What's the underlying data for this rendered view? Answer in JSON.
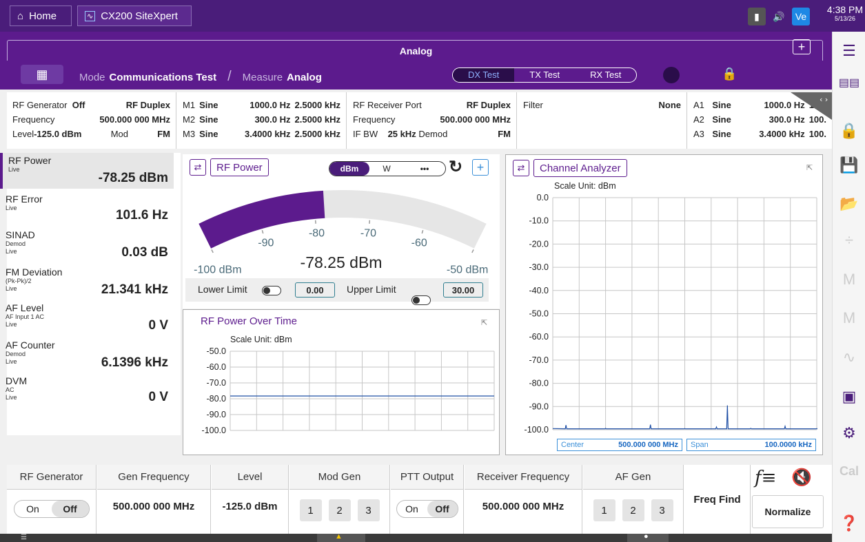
{
  "topbar": {
    "home_label": "Home",
    "app_label": "CX200 SiteXpert",
    "vnc_label": "Ve",
    "time": "4:38 PM",
    "date": "5/13/26"
  },
  "header": {
    "title": "Analog",
    "mode_label": "Mode",
    "mode_value": "Communications Test",
    "measure_label": "Measure",
    "measure_value": "Analog",
    "tests": [
      "DX Test",
      "TX Test",
      "RX Test"
    ],
    "active_test": "DX Test"
  },
  "sidebar_right": {
    "cal_label": "Cal"
  },
  "settings": {
    "rf_generator": {
      "label": "RF Generator",
      "state": "Off",
      "port": "RF Duplex",
      "freq_label": "Frequency",
      "freq": "500.000 000 MHz",
      "level_label": "Level",
      "level": "-125.0 dBm",
      "mod_label": "Mod",
      "mod": "FM"
    },
    "modulators": [
      {
        "id": "M1",
        "type": "Sine",
        "freq": "1000.0 Hz",
        "dev": "2.5000 kHz"
      },
      {
        "id": "M2",
        "type": "Sine",
        "freq": "300.0 Hz",
        "dev": "2.5000 kHz"
      },
      {
        "id": "M3",
        "type": "Sine",
        "freq": "3.4000 kHz",
        "dev": "2.5000 kHz"
      }
    ],
    "receiver": {
      "port_label": "RF Receiver Port",
      "port": "RF Duplex",
      "freq_label": "Frequency",
      "freq": "500.000 000 MHz",
      "ifbw_label": "IF BW",
      "ifbw": "25 kHz",
      "demod_label": "Demod",
      "demod": "FM"
    },
    "filter": {
      "label": "Filter",
      "value": "None"
    },
    "audio": [
      {
        "id": "A1",
        "type": "Sine",
        "freq": "1000.0 Hz",
        "extra": "100."
      },
      {
        "id": "A2",
        "type": "Sine",
        "freq": "300.0 Hz",
        "extra": "100."
      },
      {
        "id": "A3",
        "type": "Sine",
        "freq": "3.4000 kHz",
        "extra": "100."
      }
    ]
  },
  "measurements": [
    {
      "name": "RF Power",
      "sub": [
        "Live"
      ],
      "value": "-78.25 dBm"
    },
    {
      "name": "RF Error",
      "sub": [
        "Live"
      ],
      "value": "101.6 Hz"
    },
    {
      "name": "SINAD",
      "sub": [
        "Demod",
        "Live"
      ],
      "value": "0.03 dB"
    },
    {
      "name": "FM Deviation",
      "sub": [
        "(Pk-Pk)/2",
        "Live"
      ],
      "value": "21.341 kHz"
    },
    {
      "name": "AF Level",
      "sub": [
        "AF Input 1 AC",
        "Live"
      ],
      "value": "0 V"
    },
    {
      "name": "AF Counter",
      "sub": [
        "Demod",
        "Live"
      ],
      "value": "6.1396 kHz"
    },
    {
      "name": "DVM",
      "sub": [
        "AC",
        "Live"
      ],
      "value": "0 V"
    }
  ],
  "rf_power_panel": {
    "title": "RF Power",
    "units": [
      "dBm",
      "W"
    ],
    "active_unit": "dBm",
    "more": "•••",
    "gauge": {
      "min": -100,
      "max": -50,
      "value": -78.25,
      "tick_labels": [
        "-100 dBm",
        "-90",
        "-80",
        "-70",
        "-60",
        "-50 dBm"
      ],
      "readout": "-78.25 dBm"
    },
    "lower_limit_label": "Lower Limit",
    "lower_limit": "0.00",
    "upper_limit_label": "Upper Limit",
    "upper_limit": "30.00"
  },
  "chart_data": [
    {
      "type": "line",
      "title": "RF Power Over Time",
      "subtitle": "Scale Unit: dBm",
      "ylim": [
        -100,
        -50
      ],
      "yticks": [
        "-50.0",
        "-60.0",
        "-70.0",
        "-80.0",
        "-90.0",
        "-100.0"
      ],
      "series": [
        {
          "values": [
            -78.25,
            -78.25
          ]
        }
      ],
      "grid": true
    },
    {
      "type": "line",
      "title": "Channel Analyzer",
      "subtitle": "Scale Unit: dBm",
      "ylim": [
        -100,
        0
      ],
      "yticks": [
        "0.0",
        "-10.0",
        "-20.0",
        "-30.0",
        "-40.0",
        "-50.0",
        "-60.0",
        "-70.0",
        "-80.0",
        "-90.0",
        "-100.0"
      ],
      "center_label": "Center",
      "center": "500.000 000 MHz",
      "span_label": "Span",
      "span": "100.0000 kHz",
      "spectrum": [
        {
          "x": 0.0,
          "y": -99.5
        },
        {
          "x": 0.05,
          "y": -98
        },
        {
          "x": 0.1,
          "y": -99.6
        },
        {
          "x": 0.2,
          "y": -99.4
        },
        {
          "x": 0.3,
          "y": -99.6
        },
        {
          "x": 0.37,
          "y": -97.8
        },
        {
          "x": 0.5,
          "y": -99.5
        },
        {
          "x": 0.62,
          "y": -98.8
        },
        {
          "x": 0.6615,
          "y": -89.5
        },
        {
          "x": 0.75,
          "y": -99.4
        },
        {
          "x": 0.88,
          "y": -98.5
        },
        {
          "x": 1.0,
          "y": -99.5
        }
      ],
      "grid": true
    }
  ],
  "bottom": {
    "rf_generator": {
      "label": "RF Generator",
      "on": "On",
      "off": "Off",
      "selected": "Off"
    },
    "gen_frequency": {
      "label": "Gen Frequency",
      "value": "500.000 000 MHz"
    },
    "level": {
      "label": "Level",
      "value": "-125.0 dBm"
    },
    "mod_gen": {
      "label": "Mod Gen",
      "buttons": [
        "1",
        "2",
        "3"
      ]
    },
    "ptt_output": {
      "label": "PTT Output",
      "on": "On",
      "off": "Off",
      "selected": "Off"
    },
    "receiver_frequency": {
      "label": "Receiver Frequency",
      "value": "500.000 000 MHz"
    },
    "af_gen": {
      "label": "AF Gen",
      "buttons": [
        "1",
        "2",
        "3"
      ]
    },
    "freq_find": "Freq Find",
    "normalize": "Normalize"
  },
  "colors": {
    "brand": "#4a1d7a",
    "accent": "#5c1b8d",
    "trace": "#1f4fa5"
  }
}
